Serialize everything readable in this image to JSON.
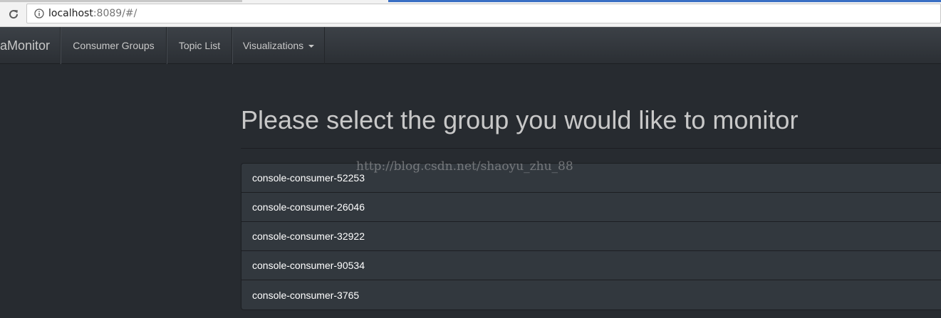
{
  "browser": {
    "url_host": "localhost",
    "url_rest": ":8089/#/"
  },
  "navbar": {
    "brand": "aMonitor",
    "items": [
      {
        "label": "Consumer Groups"
      },
      {
        "label": "Topic List"
      },
      {
        "label": "Visualizations"
      }
    ]
  },
  "main": {
    "title": "Please select the group you would like to monitor",
    "groups": [
      "console-consumer-52253",
      "console-consumer-26046",
      "console-consumer-32922",
      "console-consumer-90534",
      "console-consumer-3765"
    ]
  },
  "watermark": "http://blog.csdn.net/shaoyu_zhu_88",
  "colors": {
    "background": "#272b30",
    "navbar": "#3a3f44",
    "list_item": "#32383e",
    "text": "#c8c8c8"
  },
  "icons": [
    "reload-icon",
    "info-icon",
    "caret-down-icon"
  ]
}
